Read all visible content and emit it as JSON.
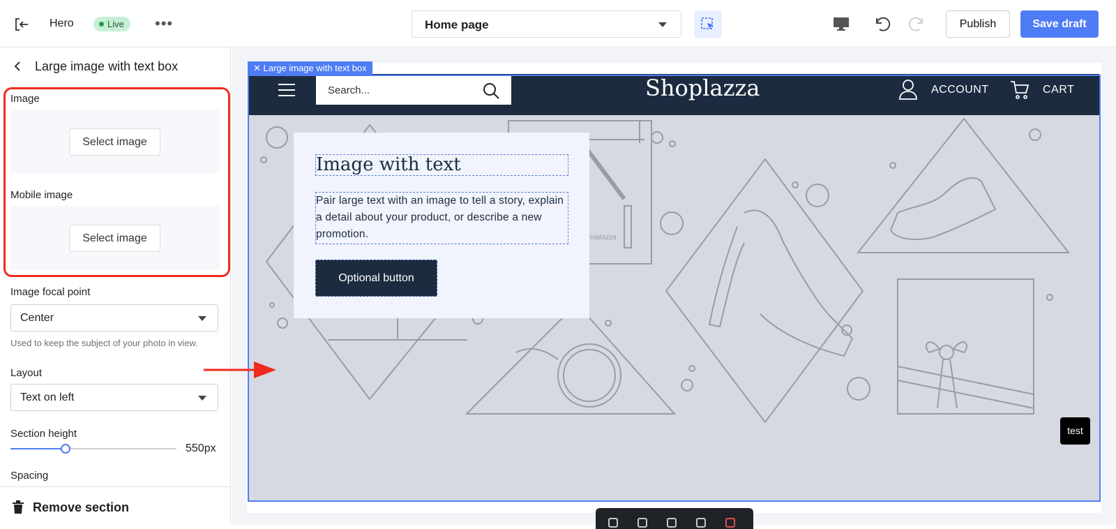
{
  "topbar": {
    "title": "Hero",
    "status": "Live",
    "page_select": "Home page",
    "publish_label": "Publish",
    "save_label": "Save draft"
  },
  "sidebar": {
    "title": "Large image with text box",
    "image_label": "Image",
    "image_button": "Select image",
    "mobile_image_label": "Mobile image",
    "mobile_image_button": "Select image",
    "focal_label": "Image focal point",
    "focal_value": "Center",
    "focal_hint": "Used to keep the subject of your photo in view.",
    "layout_label": "Layout",
    "layout_value": "Text on left",
    "height_label": "Section height",
    "height_value": "550px",
    "height_fraction": 0.33,
    "spacing_label": "Spacing",
    "remove_label": "Remove section"
  },
  "preview": {
    "section_tag": "Large image with text box",
    "search_placeholder": "Search...",
    "store_logo": "Shoplazza",
    "account_label": "ACCOUNT",
    "cart_label": "CART",
    "heading": "Image with text",
    "body": "Pair large text with an image to tell a story, explain a detail about your product, or describe a new promotion.",
    "button_label": "Optional button",
    "box_label": "Shoplazza",
    "test_label": "test"
  },
  "colors": {
    "accent": "#4e7cf5",
    "store_header": "#1c2b40",
    "hero_bg": "#d6d9e1",
    "highlight": "#ee2b1e"
  }
}
